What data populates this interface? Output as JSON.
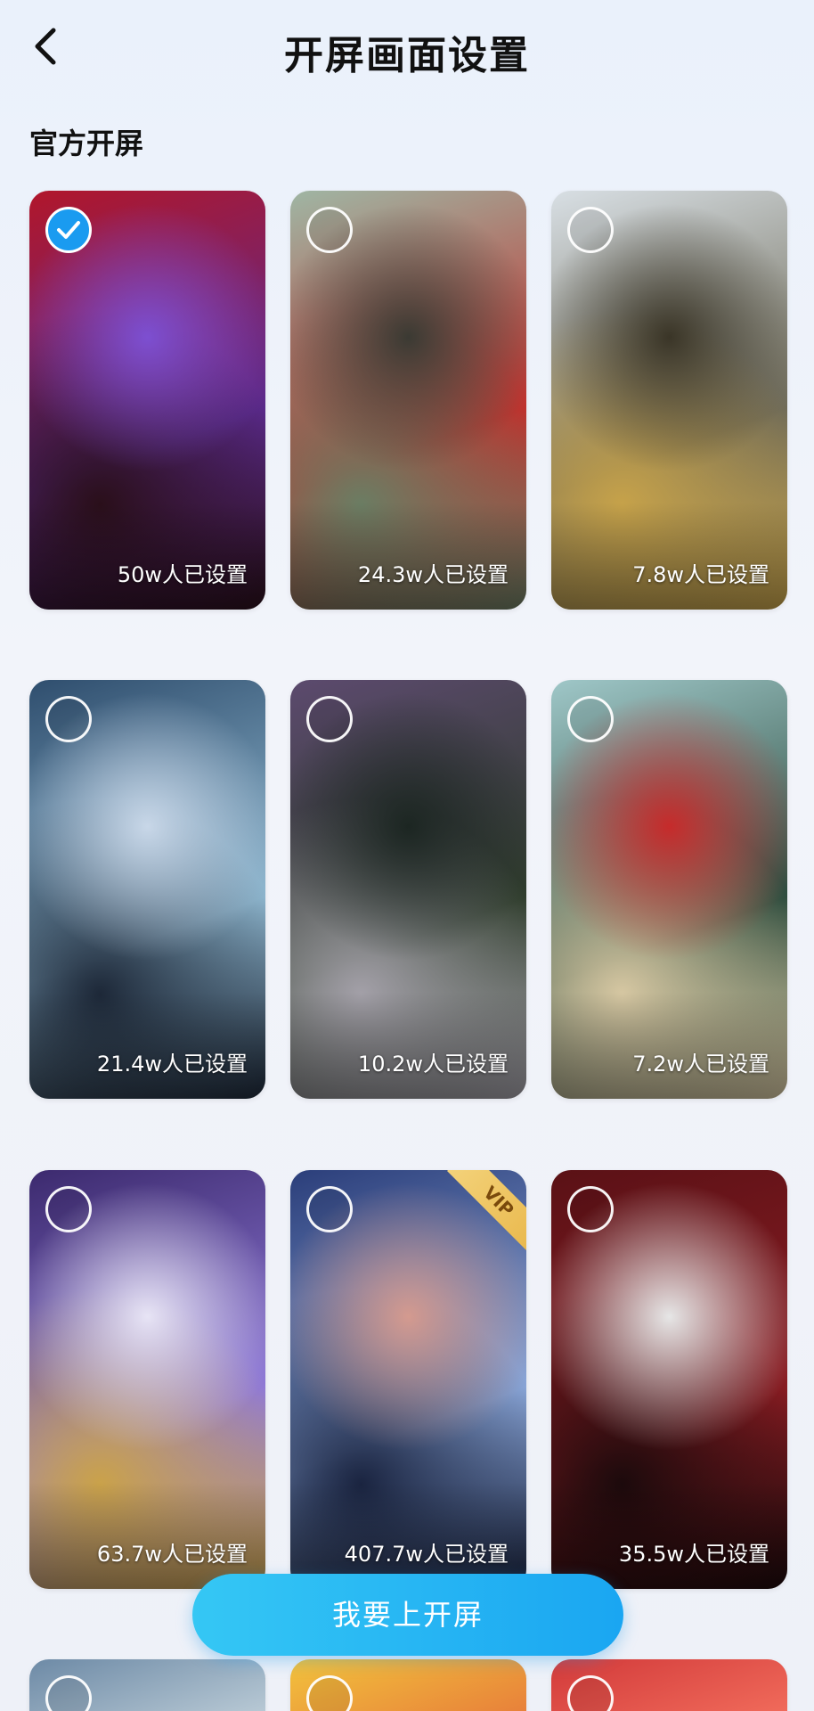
{
  "header": {
    "title": "开屏画面设置",
    "back_icon": "back-arrow-icon"
  },
  "section": {
    "title": "官方开屏"
  },
  "cards": [
    {
      "count": "50w人已设置",
      "selected": true,
      "vip": false,
      "colors": [
        "#b1162b",
        "#5a2a8c",
        "#7d4fd1",
        "#2a0f1a"
      ]
    },
    {
      "count": "24.3w人已设置",
      "selected": false,
      "vip": false,
      "colors": [
        "#9fb6a4",
        "#c0302c",
        "#3b3a33",
        "#6b7d63"
      ]
    },
    {
      "count": "7.8w人已设置",
      "selected": false,
      "vip": false,
      "colors": [
        "#d8dfe4",
        "#6e6a58",
        "#3a3527",
        "#c6a24a"
      ]
    },
    {
      "count": "21.4w人已设置",
      "selected": false,
      "vip": false,
      "colors": [
        "#2f4e6e",
        "#8fb7cf",
        "#c8d7e8",
        "#1d2838"
      ]
    },
    {
      "count": "10.2w人已设置",
      "selected": false,
      "vip": false,
      "colors": [
        "#5c4a6e",
        "#2d3b2a",
        "#1c2622",
        "#a3a0a8"
      ]
    },
    {
      "count": "7.2w人已设置",
      "selected": false,
      "vip": false,
      "colors": [
        "#9fc7c8",
        "#2b4a3c",
        "#c62b2b",
        "#d6c7a2"
      ]
    },
    {
      "count": "63.7w人已设置",
      "selected": false,
      "vip": false,
      "colors": [
        "#3c2a6e",
        "#8f79d8",
        "#e7e4f5",
        "#caa24a"
      ]
    },
    {
      "count": "407.7w人已设置",
      "selected": false,
      "vip": true,
      "colors": [
        "#2b3e7a",
        "#8aa6d8",
        "#d49a8f",
        "#1a2440"
      ]
    },
    {
      "count": "35.5w人已设置",
      "selected": false,
      "vip": false,
      "colors": [
        "#5a1116",
        "#8a1c22",
        "#e6e6e6",
        "#1c0a0c"
      ]
    }
  ],
  "bottom_row_colors": [
    [
      "#6d8aa6",
      "#b7c8d4"
    ],
    [
      "#f2c23c",
      "#e8813a"
    ],
    [
      "#d23a3a",
      "#f06a5a"
    ]
  ],
  "vip_label": "VIP",
  "cta": {
    "label": "我要上开屏"
  }
}
